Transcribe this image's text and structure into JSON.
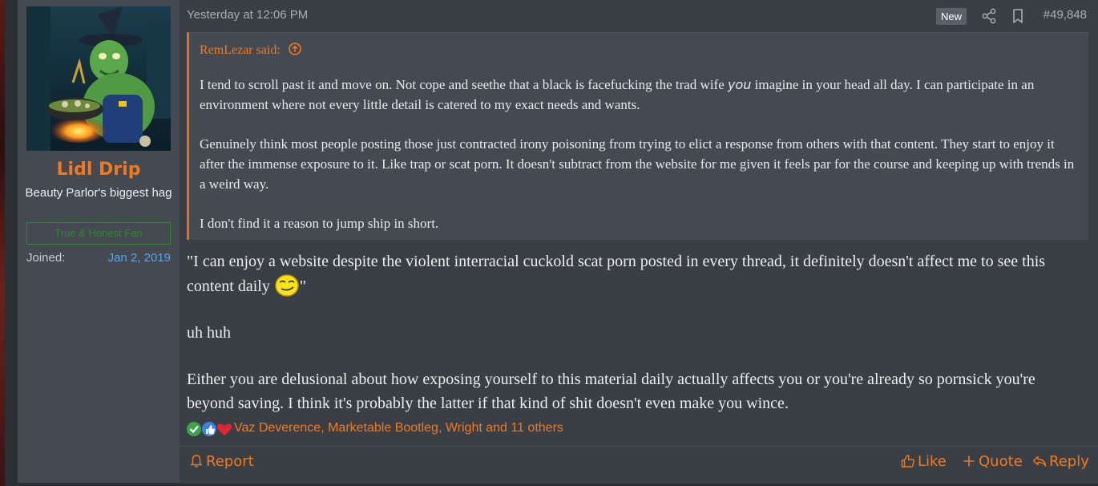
{
  "user": {
    "name": "Lidl Drip",
    "title": "Beauty Parlor's biggest hag",
    "banner": "True & Honest Fan",
    "joined_label": "Joined:",
    "joined_date": "Jan 2, 2019"
  },
  "post": {
    "timestamp": "Yesterday at 12:06 PM",
    "new_badge": "New",
    "number": "#49,848"
  },
  "quote": {
    "author": "RemLezar said:",
    "p1a": "I tend to scroll past it and move on. Not cope and seethe that a black is facefucking the trad wife ",
    "p1_em": "you",
    "p1b": " imagine in your head all day. I can participate in an environment where not every little detail is catered to my exact needs and wants.",
    "p2": "Genuinely think most people posting those just contracted irony poisoning from trying to elict a response from others with that content. They start to enjoy it after the immense exposure to it. Like trap or scat porn. It doesn't subtract from the website for me given it feels par for the course and keeping up with trends in a weird way.",
    "p3": "I don't find it a reason to jump ship in short."
  },
  "body": {
    "p1": "\"I can enjoy a website despite the violent interracial cuckold scat porn posted in every thread, it definitely doesn't affect me to see this content daily ",
    "p1_end": "\"",
    "p2": "uh huh",
    "p3": "Either you are delusional about how exposing yourself to this material daily actually affects you or you're already so pornsick you're beyond saving. I think it's probably the latter if that kind of shit doesn't even make you wince."
  },
  "reactions": {
    "icons": [
      "check-reaction-icon",
      "thumbs-up-reaction-icon",
      "heart-reaction-icon"
    ],
    "names": "Vaz Deverence, Marketable Bootleg, Wright and 11 others"
  },
  "footer": {
    "report": "Report",
    "like": "Like",
    "quote": "Quote",
    "reply": "Reply"
  },
  "colors": {
    "accent": "#f07a1f",
    "link_blue": "#5aa3e8",
    "banner_green": "#2f8a2f",
    "post_bg": "#3a3e45",
    "user_bg": "#454a52"
  }
}
